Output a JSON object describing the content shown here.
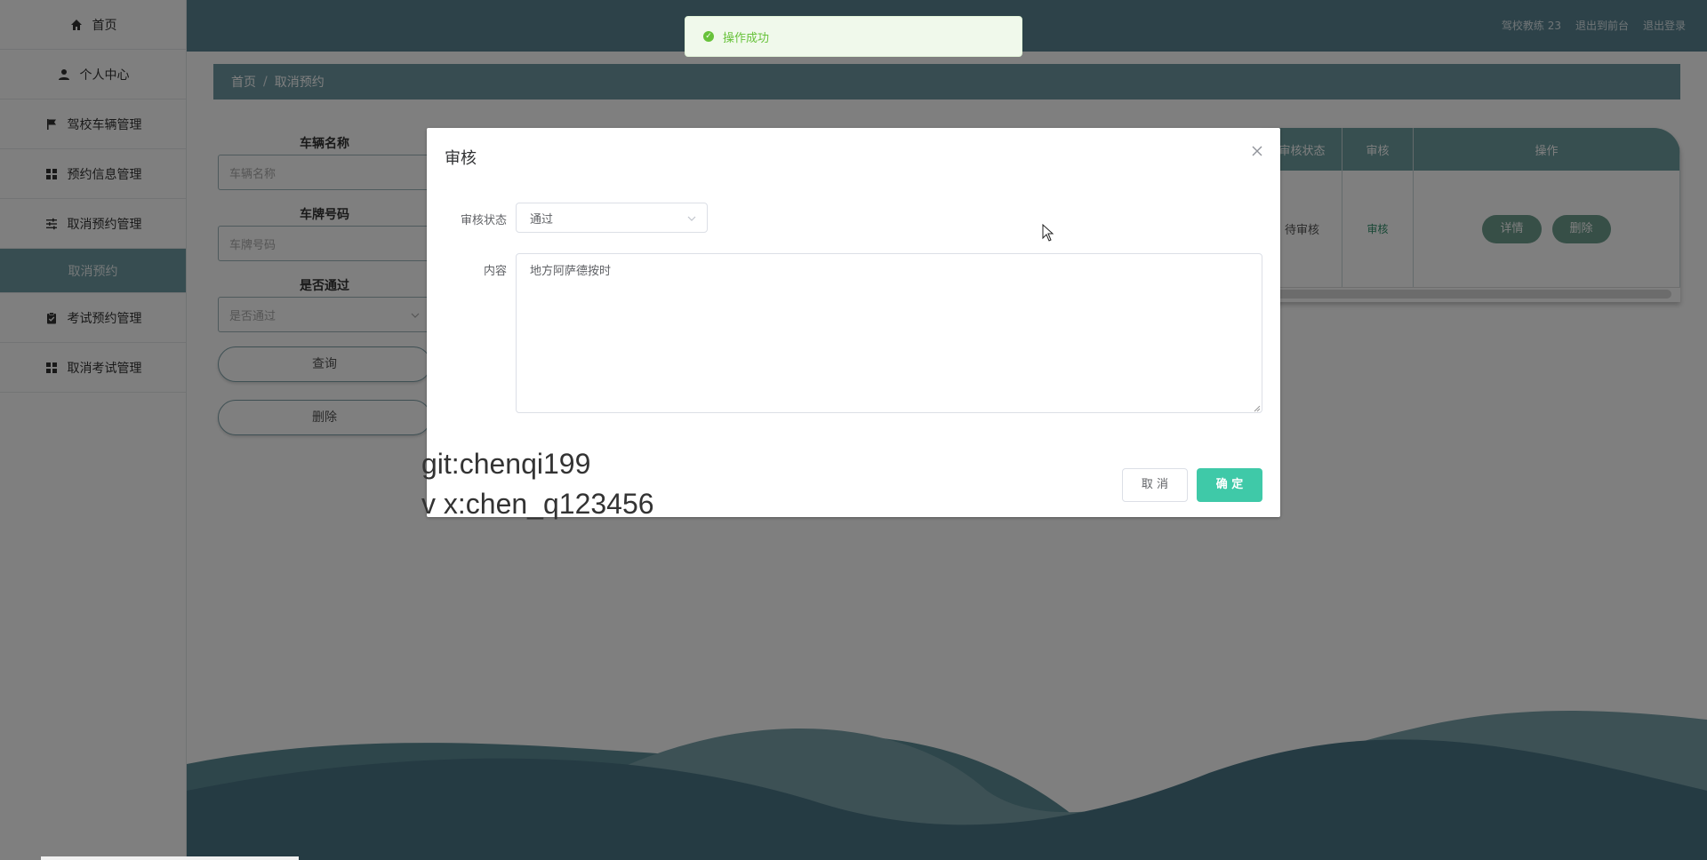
{
  "sidebar": {
    "items": [
      {
        "label": "首页",
        "icon": "home-icon"
      },
      {
        "label": "个人中心",
        "icon": "user-icon"
      },
      {
        "label": "驾校车辆管理",
        "icon": "flag-icon"
      },
      {
        "label": "预约信息管理",
        "icon": "grid-icon"
      },
      {
        "label": "取消预约管理",
        "icon": "sliders-icon"
      },
      {
        "label": "取消预约",
        "icon": ""
      },
      {
        "label": "考试预约管理",
        "icon": "clipboard-icon"
      },
      {
        "label": "取消考试管理",
        "icon": "grid-icon"
      }
    ]
  },
  "topbar": {
    "user": "驾校教练 23",
    "front": "退出到前台",
    "logout": "退出登录"
  },
  "breadcrumb": {
    "home": "首页",
    "sep": "/",
    "current": "取消预约"
  },
  "search": {
    "vehicle_name_label": "车辆名称",
    "vehicle_name_placeholder": "车辆名称",
    "plate_label": "车牌号码",
    "plate_placeholder": "车牌号码",
    "passed_label": "是否通过",
    "passed_placeholder": "是否通过",
    "query_button": "查询",
    "delete_button": "删除"
  },
  "table": {
    "headers": [
      "审核状态",
      "审核",
      "操作"
    ],
    "rows": [
      {
        "status": "待审核",
        "review": "审核",
        "detail": "详情",
        "delete": "删除"
      }
    ]
  },
  "toast": {
    "message": "操作成功"
  },
  "dialog": {
    "title": "审核",
    "status_label": "审核状态",
    "status_value": "通过",
    "content_label": "内容",
    "content_value": "地方阿萨德按时",
    "cancel": "取 消",
    "confirm": "确 定"
  },
  "watermark": {
    "line1": "git:chenqi199",
    "line2": "v x:chen_q123456"
  },
  "colors": {
    "primary": "#5a8593",
    "accent_green": "#3fc9a8",
    "success": "#67c23a"
  }
}
